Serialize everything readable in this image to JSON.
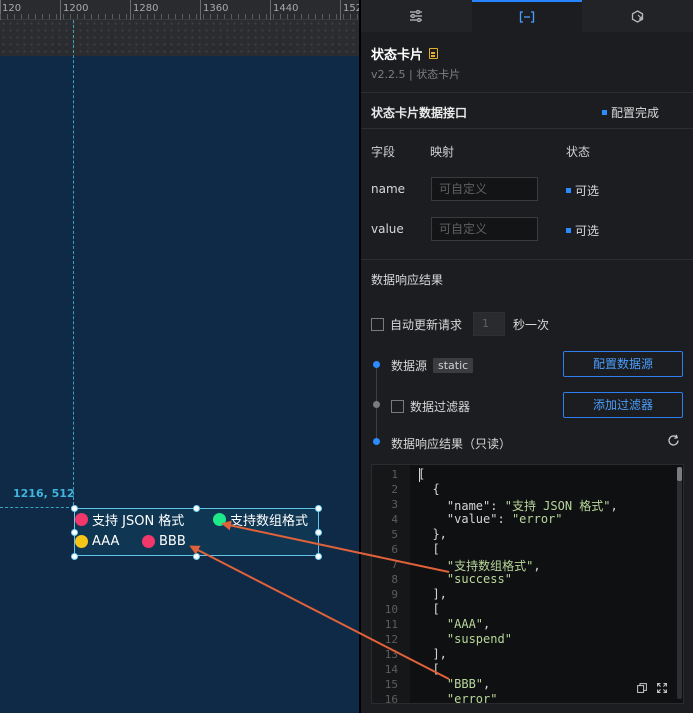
{
  "ruler": {
    "labels": [
      "120",
      "1200",
      "1280",
      "1360",
      "1440",
      "152"
    ]
  },
  "canvas": {
    "coord_readout": "1216, 512",
    "widget_items": [
      {
        "label": "支持 JSON 格式",
        "color": "#f0386b"
      },
      {
        "label": "支持数组格式",
        "color": "#1fe88a"
      },
      {
        "label": "AAA",
        "color": "#f5c518"
      },
      {
        "label": "BBB",
        "color": "#f0386b"
      }
    ]
  },
  "panel": {
    "tabs": [
      {
        "name": "sliders-icon",
        "active": false
      },
      {
        "name": "data-interface-icon",
        "active": true
      },
      {
        "name": "interaction-icon",
        "active": false
      }
    ],
    "title": "状态卡片",
    "version": "v2.2.5 | 状态卡片",
    "data_interface": {
      "title": "状态卡片数据接口",
      "config_status": "配置完成",
      "headers": {
        "field": "字段",
        "mapping": "映射",
        "status": "状态"
      },
      "fields": [
        {
          "name": "name",
          "placeholder": "可自定义",
          "status": "可选"
        },
        {
          "name": "value",
          "placeholder": "可自定义",
          "status": "可选"
        }
      ]
    },
    "result_section": {
      "title": "数据响应结果",
      "auto_update_label": "自动更新请求",
      "interval_value": "1",
      "interval_unit": "秒一次"
    },
    "pipeline": {
      "source_label": "数据源",
      "source_badge": "static",
      "config_source_button": "配置数据源",
      "filter_label": "数据过滤器",
      "add_filter_button": "添加过滤器",
      "result_label": "数据响应结果（只读）"
    },
    "code": {
      "line_numbers": [
        "1",
        "2",
        "3",
        "4",
        "5",
        "6",
        "7",
        "8",
        "9",
        "10",
        "11",
        "12",
        "13",
        "14",
        "15",
        "16"
      ],
      "lines": [
        "[",
        "  {",
        "    \"name\": \"支持 JSON 格式\",",
        "    \"value\": \"error\"",
        "  },",
        "  [",
        "    \"支持数组格式\",",
        "    \"success\"",
        "  ],",
        "  [",
        "    \"AAA\",",
        "    \"suspend\"",
        "  ],",
        "  [",
        "    \"BBB\",",
        "    \"error\""
      ]
    }
  },
  "colors": {
    "accent": "#2a8cff",
    "arrow": "#e0623a",
    "canvas_bg": "#0e2a47"
  }
}
